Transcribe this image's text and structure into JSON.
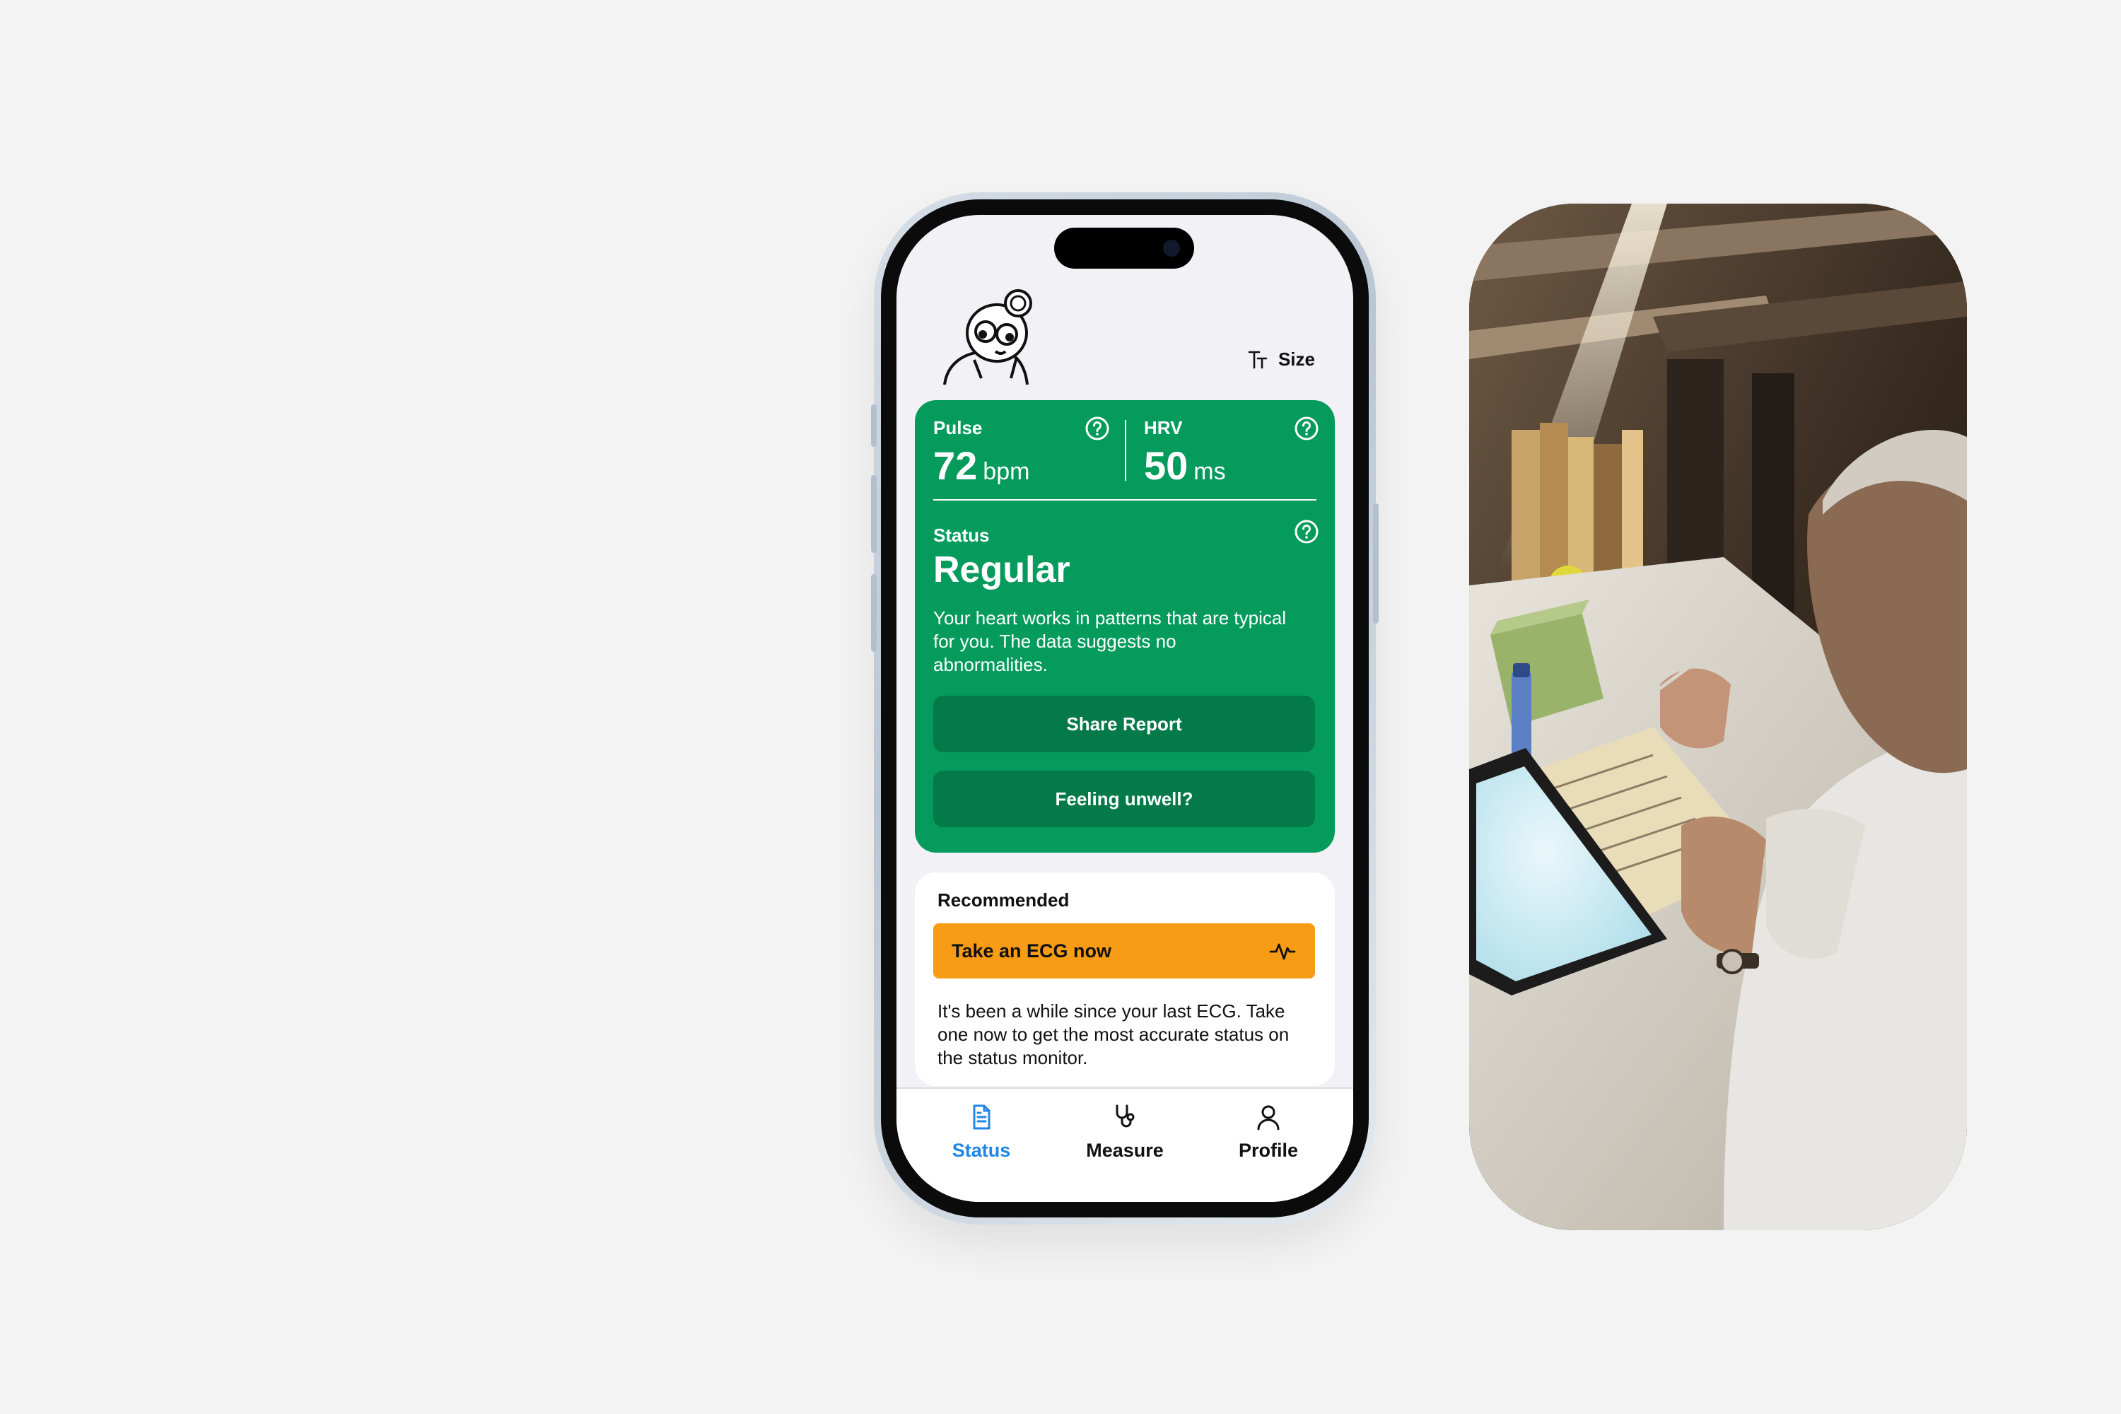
{
  "header": {
    "size_label": "Size",
    "size_icon": "text-size-icon",
    "mascot": "doctor-mascot-illustration"
  },
  "status_card": {
    "background_color": "#059b5d",
    "pulse": {
      "label": "Pulse",
      "value": "72",
      "unit": "bpm"
    },
    "hrv": {
      "label": "HRV",
      "value": "50",
      "unit": "ms"
    },
    "status_label": "Status",
    "status_value": "Regular",
    "description": "Your heart works in patterns that are typical for you. The data suggests no abnormalities.",
    "share_button": "Share Report",
    "unwell_button": "Feeling unwell?"
  },
  "recommended": {
    "title": "Recommended",
    "action_button": "Take an ECG now",
    "action_color": "#f79c14",
    "description": "It's been a while since your  last ECG. Take one now to  get the most accurate status on the status monitor."
  },
  "bottom_nav": {
    "active_color": "#1f86e8",
    "items": [
      {
        "label": "Status",
        "icon": "document-icon",
        "active": true
      },
      {
        "label": "Measure",
        "icon": "stethoscope-icon",
        "active": false
      },
      {
        "label": "Profile",
        "icon": "person-icon",
        "active": false
      }
    ]
  },
  "photo": {
    "subject": "elderly-man-writing-at-desk-photo"
  }
}
